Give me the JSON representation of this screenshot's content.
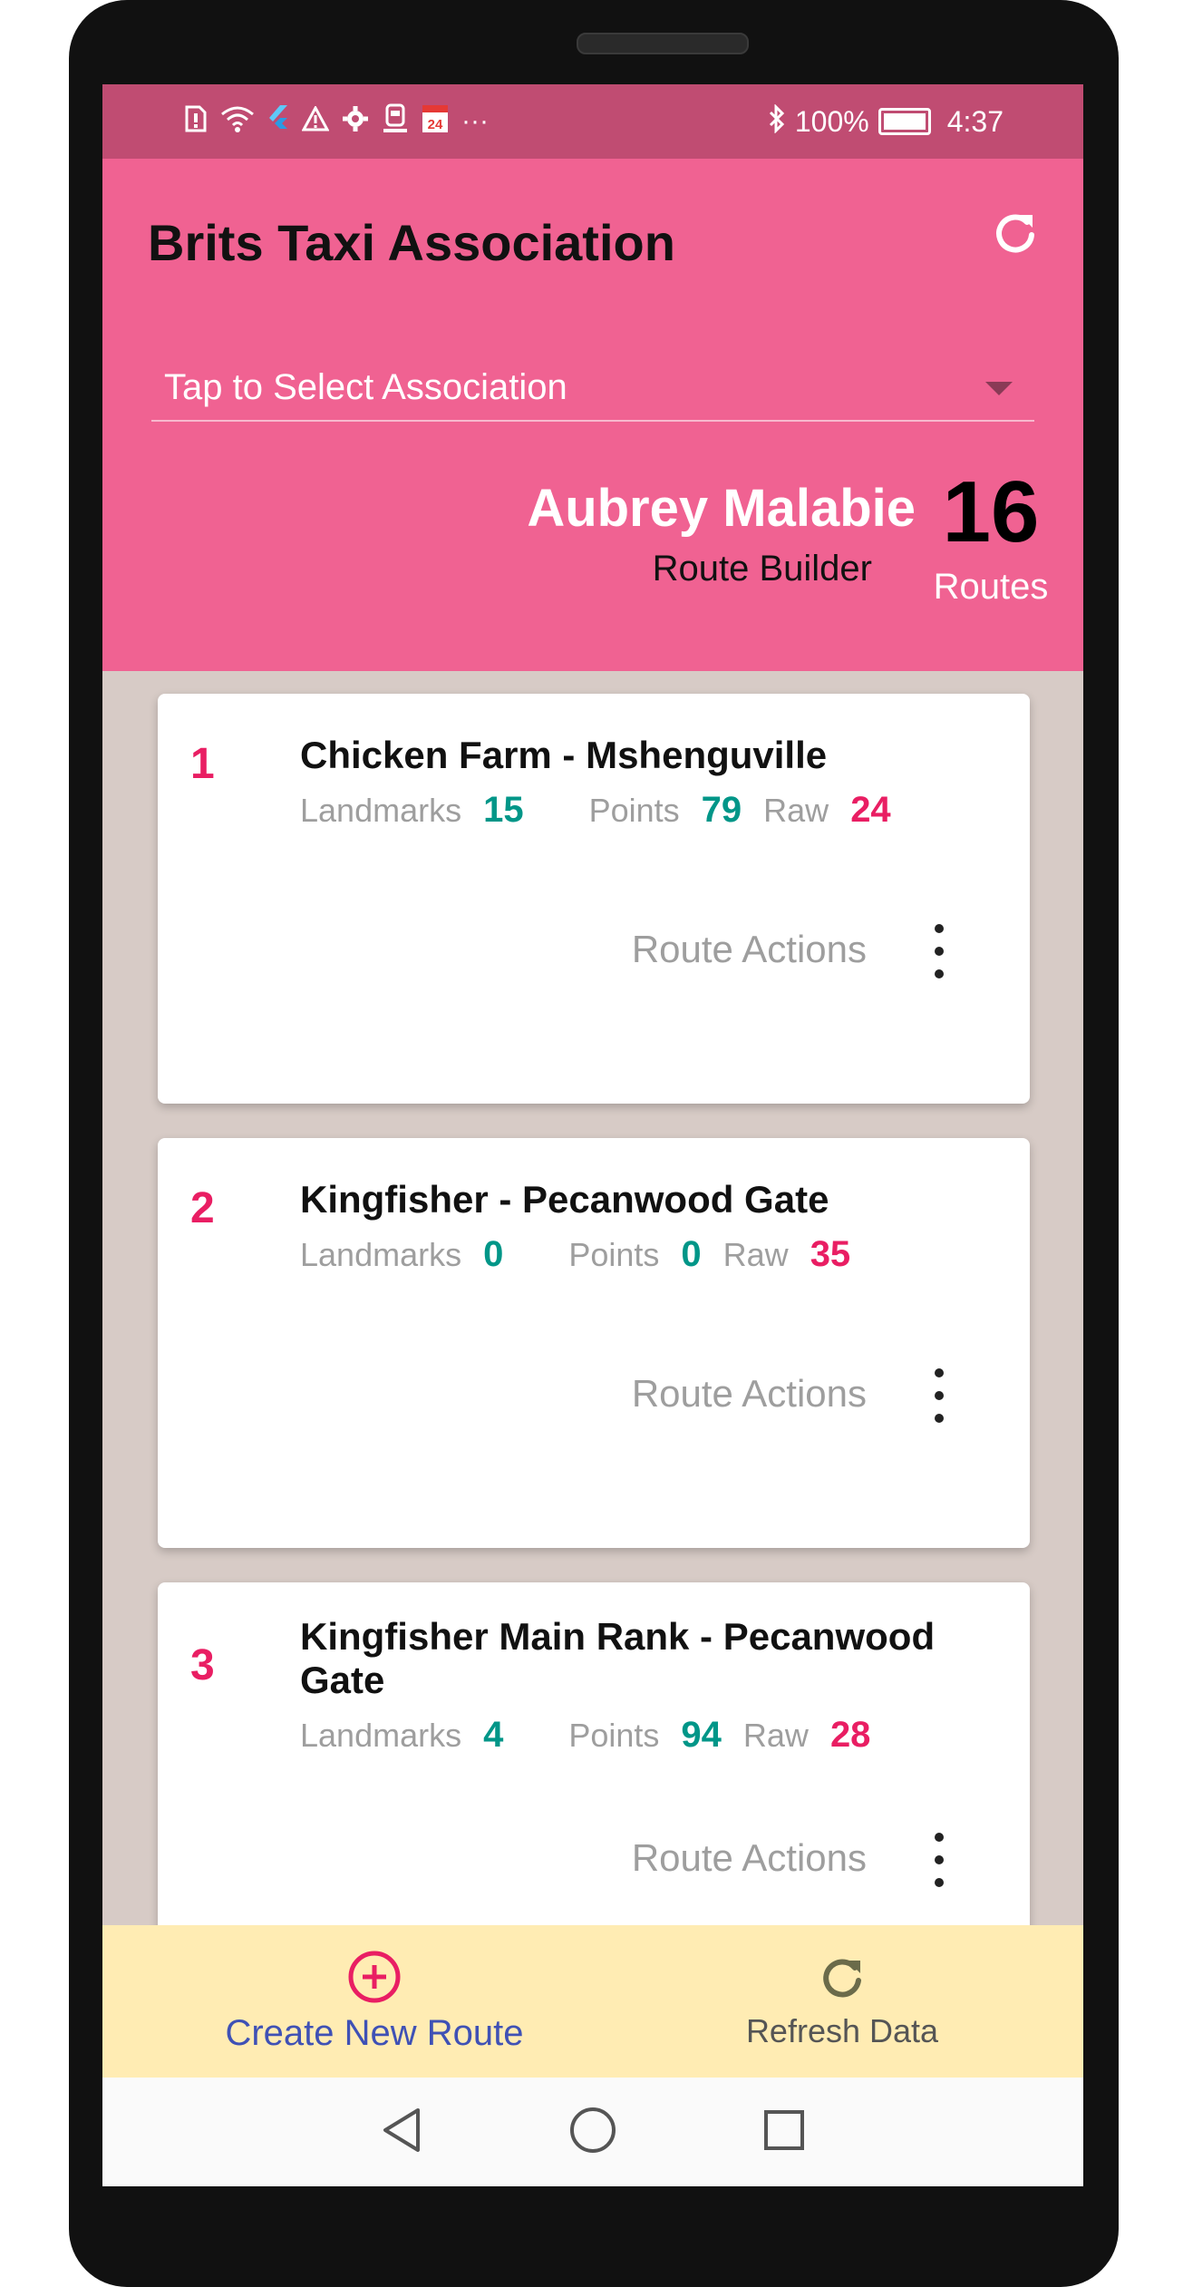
{
  "status_bar": {
    "battery": "100%",
    "time": "4:37",
    "more": "···",
    "calendar_day": "24"
  },
  "header": {
    "title": "Brits Taxi Association",
    "association_placeholder": "Tap to Select Association",
    "user_name": "Aubrey Malabie",
    "user_role": "Route Builder",
    "routes_count": "16",
    "routes_label": "Routes"
  },
  "routes": [
    {
      "number": "1",
      "title": "Chicken Farm - Mshenguville",
      "landmarks_label": "Landmarks",
      "landmarks": "15",
      "points_label": "Points",
      "points": "79",
      "raw_label": "Raw",
      "raw": "24",
      "actions_label": "Route Actions"
    },
    {
      "number": "2",
      "title": "Kingfisher - Pecanwood Gate",
      "landmarks_label": "Landmarks",
      "landmarks": "0",
      "points_label": "Points",
      "points": "0",
      "raw_label": "Raw",
      "raw": "35",
      "actions_label": "Route Actions"
    },
    {
      "number": "3",
      "title": "Kingfisher Main Rank - Pecanwood Gate",
      "landmarks_label": "Landmarks",
      "landmarks": "4",
      "points_label": "Points",
      "points": "94",
      "raw_label": "Raw",
      "raw": "28",
      "actions_label": "Route Actions"
    }
  ],
  "bottom_bar": {
    "create_label": "Create New Route",
    "refresh_label": "Refresh Data"
  },
  "colors": {
    "header": "#f06292",
    "status_bar": "#c04c72",
    "accent_pink": "#e91e63",
    "accent_teal": "#009688",
    "bottom_bar": "#ffecb3",
    "create_label": "#3f51b5"
  },
  "icons": {
    "header_refresh": "refresh-icon",
    "dropdown": "chevron-down-icon",
    "kebab": "more-vert-icon",
    "create": "add-circle-icon",
    "refresh": "refresh-icon",
    "nav_back": "back-icon",
    "nav_home": "home-icon",
    "nav_recents": "recents-icon"
  }
}
